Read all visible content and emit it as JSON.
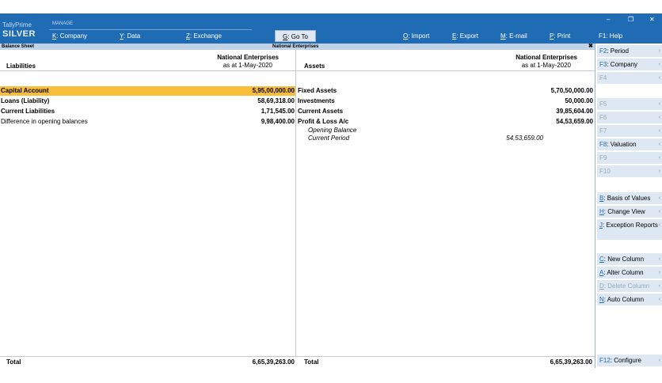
{
  "app": {
    "brand_top": "TallyPrime",
    "brand_bottom": "SILVER",
    "manage": "MANAGE"
  },
  "menu": [
    {
      "key": "K",
      "label": ": Company"
    },
    {
      "key": "Y",
      "label": ": Data"
    },
    {
      "key": "Z",
      "label": ": Exchange"
    },
    {
      "key": "G",
      "label": ": Go To"
    },
    {
      "key": "O",
      "label": ": Import"
    },
    {
      "key": "E",
      "label": ": Export"
    },
    {
      "key": "M",
      "label": ": E-mail"
    },
    {
      "key": "P",
      "label": ": Print"
    },
    {
      "key": "F1",
      "label": ": Help"
    }
  ],
  "window": {
    "minimize": "–",
    "restore": "❐",
    "close": "✕"
  },
  "report": {
    "name": "Balance Sheet",
    "company_bar": "National Enterprises",
    "close": "✖"
  },
  "liabilities": {
    "heading": "Liabilities",
    "company": "National Enterprises",
    "as_at": "as at 1-May-2020",
    "rows": [
      {
        "label": "Capital Account",
        "value": "5,95,00,000.00"
      },
      {
        "label": "Loans (Liability)",
        "value": "58,69,318.00"
      },
      {
        "label": "Current Liabilities",
        "value": "1,71,545.00"
      },
      {
        "label": "Difference in opening balances",
        "value": "9,98,400.00"
      }
    ],
    "total_label": "Total",
    "total_value": "6,65,39,263.00"
  },
  "assets": {
    "heading": "Assets",
    "company": "National Enterprises",
    "as_at": "as at 1-May-2020",
    "rows": [
      {
        "label": "Fixed Assets",
        "value": "5,70,50,000.00"
      },
      {
        "label": "Investments",
        "value": "50,000.00"
      },
      {
        "label": "Current Assets",
        "value": "39,85,604.00"
      },
      {
        "label": "Profit & Loss A/c",
        "value": "54,53,659.00"
      }
    ],
    "sub_rows": [
      {
        "label": "Opening Balance",
        "value": ""
      },
      {
        "label": "Current Period",
        "value": "54,53,659.00"
      }
    ],
    "total_label": "Total",
    "total_value": "6,65,39,263.00"
  },
  "right_buttons": [
    {
      "key": "F2",
      "label": ": Period"
    },
    {
      "key": "F3",
      "label": ": Company"
    },
    {
      "key": "F4",
      "label": ""
    },
    {
      "key": "F5",
      "label": ""
    },
    {
      "key": "F6",
      "label": ""
    },
    {
      "key": "F7",
      "label": ""
    },
    {
      "key": "F8",
      "label": ": Valuation"
    },
    {
      "key": "F9",
      "label": ""
    },
    {
      "key": "F10",
      "label": ""
    },
    {
      "key": "B",
      "label": ": Basis of Values"
    },
    {
      "key": "H",
      "label": ": Change View"
    },
    {
      "key": "J",
      "label": ": Exception Reports"
    },
    {
      "key": "C",
      "label": ": New Column"
    },
    {
      "key": "A",
      "label": ": Alter Column"
    },
    {
      "key": "D",
      "label": ": Delete Column"
    },
    {
      "key": "N",
      "label": ": Auto Column"
    },
    {
      "key": "F12",
      "label": ": Configure"
    }
  ]
}
